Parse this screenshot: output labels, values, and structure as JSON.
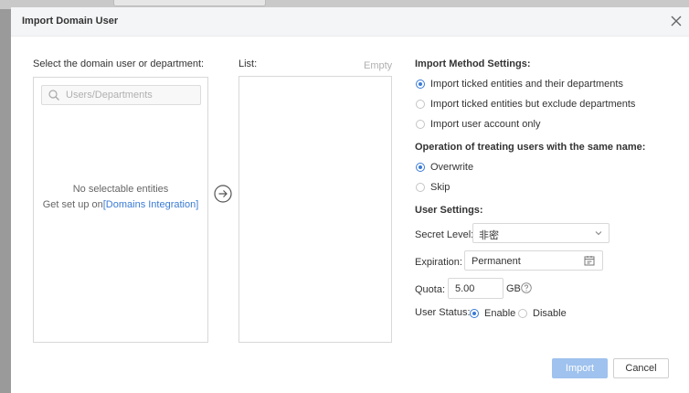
{
  "dialog": {
    "title": "Import Domain User",
    "select_label": "Select the domain user or department:",
    "search_placeholder": "Users/Departments",
    "no_entities": "No selectable entities",
    "setup_prefix": "Get set up on",
    "setup_link": "[Domains Integration]",
    "list_label": "List:",
    "empty_label": "Empty"
  },
  "import_method": {
    "title": "Import Method Settings:",
    "options": [
      {
        "label": "Import ticked entities and their departments",
        "selected": true
      },
      {
        "label": "Import ticked entities but exclude departments",
        "selected": false
      },
      {
        "label": "Import user account only",
        "selected": false
      }
    ]
  },
  "same_name": {
    "title": "Operation of treating users with the same name:",
    "options": [
      {
        "label": "Overwrite",
        "selected": true
      },
      {
        "label": "Skip",
        "selected": false
      }
    ]
  },
  "user_settings": {
    "title": "User Settings:",
    "secret_level_label": "Secret Level:",
    "secret_level_value": "非密",
    "expiration_label": "Expiration:",
    "expiration_value": "Permanent",
    "quota_label": "Quota:",
    "quota_value": "5.00",
    "quota_unit": "GB",
    "status_label": "User Status:",
    "status_options": [
      {
        "label": "Enable",
        "selected": true
      },
      {
        "label": "Disable",
        "selected": false
      }
    ]
  },
  "buttons": {
    "import": "Import",
    "cancel": "Cancel"
  },
  "colors": {
    "accent": "#3a7bd5",
    "import_button_disabled": "#9fc2ee"
  },
  "icons": [
    "close-icon",
    "search-icon",
    "arrow-right-circle-icon",
    "chevron-down-icon",
    "calendar-icon",
    "help-icon"
  ]
}
